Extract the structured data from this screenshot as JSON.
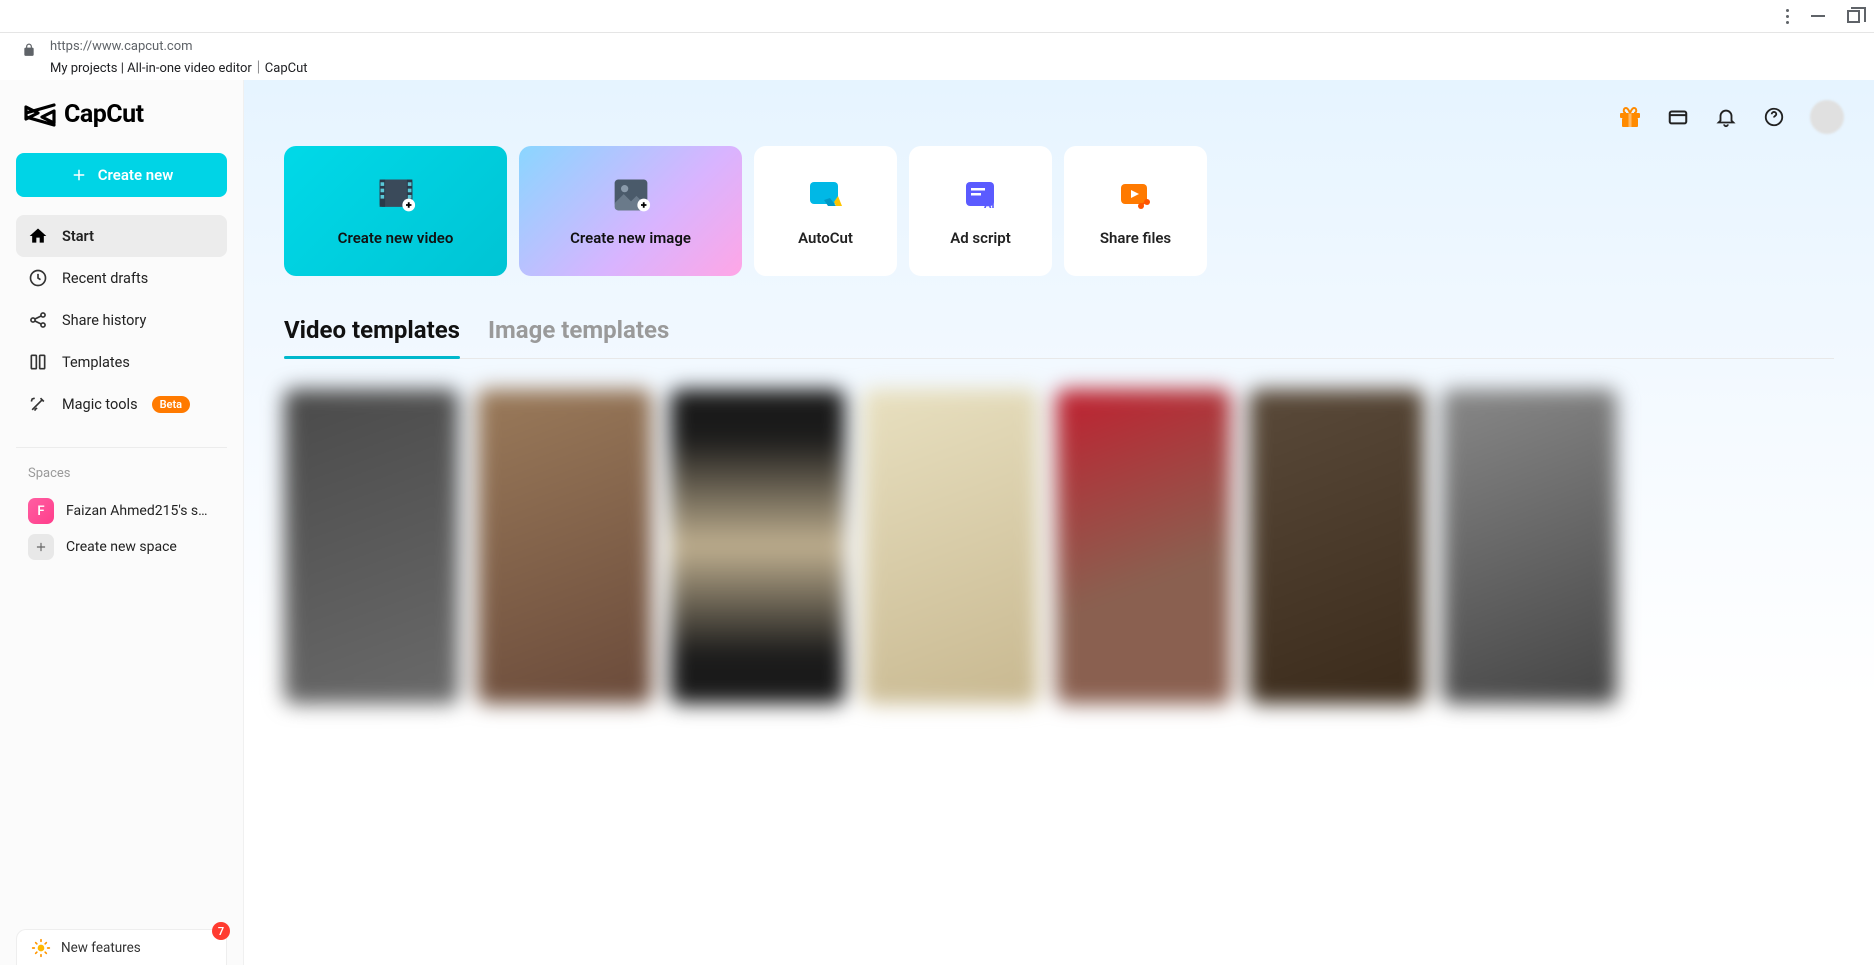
{
  "browser": {
    "url": "https://www.capcut.com",
    "page_title": "My projects | All-in-one video editor｜CapCut"
  },
  "brand": "CapCut",
  "sidebar": {
    "create_button": "Create new",
    "nav": [
      {
        "label": "Start",
        "icon": "home-icon",
        "active": true
      },
      {
        "label": "Recent drafts",
        "icon": "clock-icon"
      },
      {
        "label": "Share history",
        "icon": "share-icon"
      },
      {
        "label": "Templates",
        "icon": "templates-icon"
      },
      {
        "label": "Magic tools",
        "icon": "magic-icon",
        "badge": "Beta"
      }
    ],
    "spaces_label": "Spaces",
    "spaces": [
      {
        "initial": "F",
        "label": "Faizan Ahmed215's s…"
      }
    ],
    "create_space": "Create new space",
    "new_features": {
      "label": "New features",
      "count": "7"
    }
  },
  "actions": [
    {
      "label": "Create new video",
      "kind": "video"
    },
    {
      "label": "Create new image",
      "kind": "image"
    },
    {
      "label": "AutoCut",
      "kind": "autocut"
    },
    {
      "label": "Ad script",
      "kind": "adscript"
    },
    {
      "label": "Share files",
      "kind": "share"
    }
  ],
  "tabs": [
    {
      "label": "Video templates",
      "active": true
    },
    {
      "label": "Image templates",
      "active": false
    }
  ],
  "header_icons": [
    "gift-icon",
    "credit-icon",
    "bell-icon",
    "help-icon"
  ]
}
